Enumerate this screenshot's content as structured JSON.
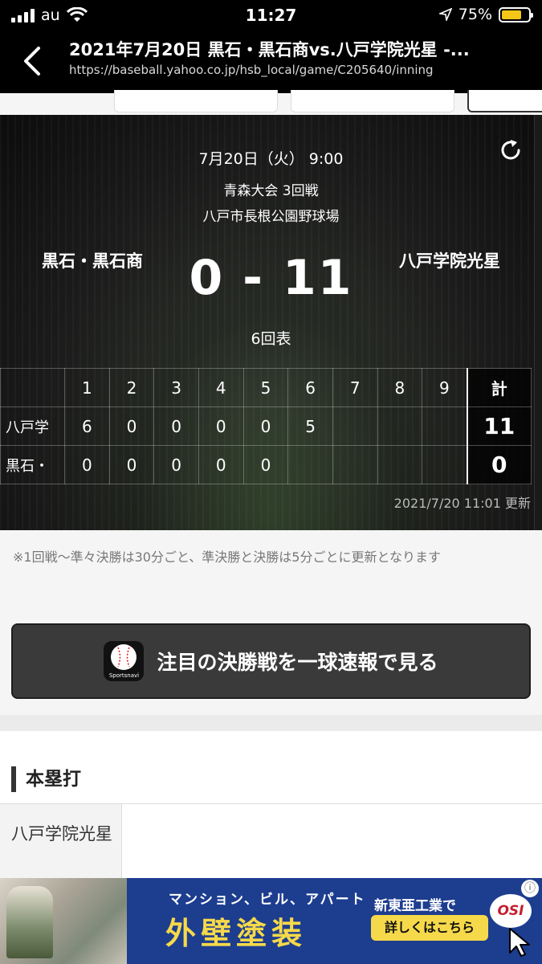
{
  "status_bar": {
    "carrier": "au",
    "time": "11:27",
    "battery": "75%",
    "battery_level": 0.75
  },
  "browser": {
    "title": "2021年7月20日 黒石・黒石商vs.八戸学院光星 -...",
    "url": "https://baseball.yahoo.co.jp/hsb_local/game/C205640/inning"
  },
  "game": {
    "date": "7月20日（火） 9:00",
    "tournament": "青森大会  3回戦",
    "venue": "八戸市長根公園野球場",
    "team_left": "黒石・黒石商",
    "team_right": "八戸学院光星",
    "score": "0 - 11",
    "status": "6回表",
    "updated": "2021/7/20 11:01  更新"
  },
  "linescore": {
    "headers": [
      "1",
      "2",
      "3",
      "4",
      "5",
      "6",
      "7",
      "8",
      "9"
    ],
    "total_header": "計",
    "rows": [
      {
        "team": "八戸学",
        "innings": [
          "6",
          "0",
          "0",
          "0",
          "0",
          "5",
          "",
          "",
          ""
        ],
        "total": "11"
      },
      {
        "team": "黒石・",
        "innings": [
          "0",
          "0",
          "0",
          "0",
          "0",
          "",
          "",
          "",
          ""
        ],
        "total": "0"
      }
    ]
  },
  "note": "※1回戦〜準々決勝は30分ごと、準決勝と決勝は5分ごとに更新となります",
  "cta": {
    "label": "注目の決勝戦を一球速報で見る",
    "icon_label": "Sportsnavi"
  },
  "home_runs": {
    "heading": "本塁打",
    "team": "八戸学院光星"
  },
  "ad": {
    "sub": "マンション、ビル、アパート",
    "main": "外壁塗装",
    "company": "新東亜工業で",
    "button": "詳しくはこちら",
    "logo": "OSI",
    "colors": {
      "background": "#1d3d8f",
      "highlight": "#f6d94a"
    }
  }
}
